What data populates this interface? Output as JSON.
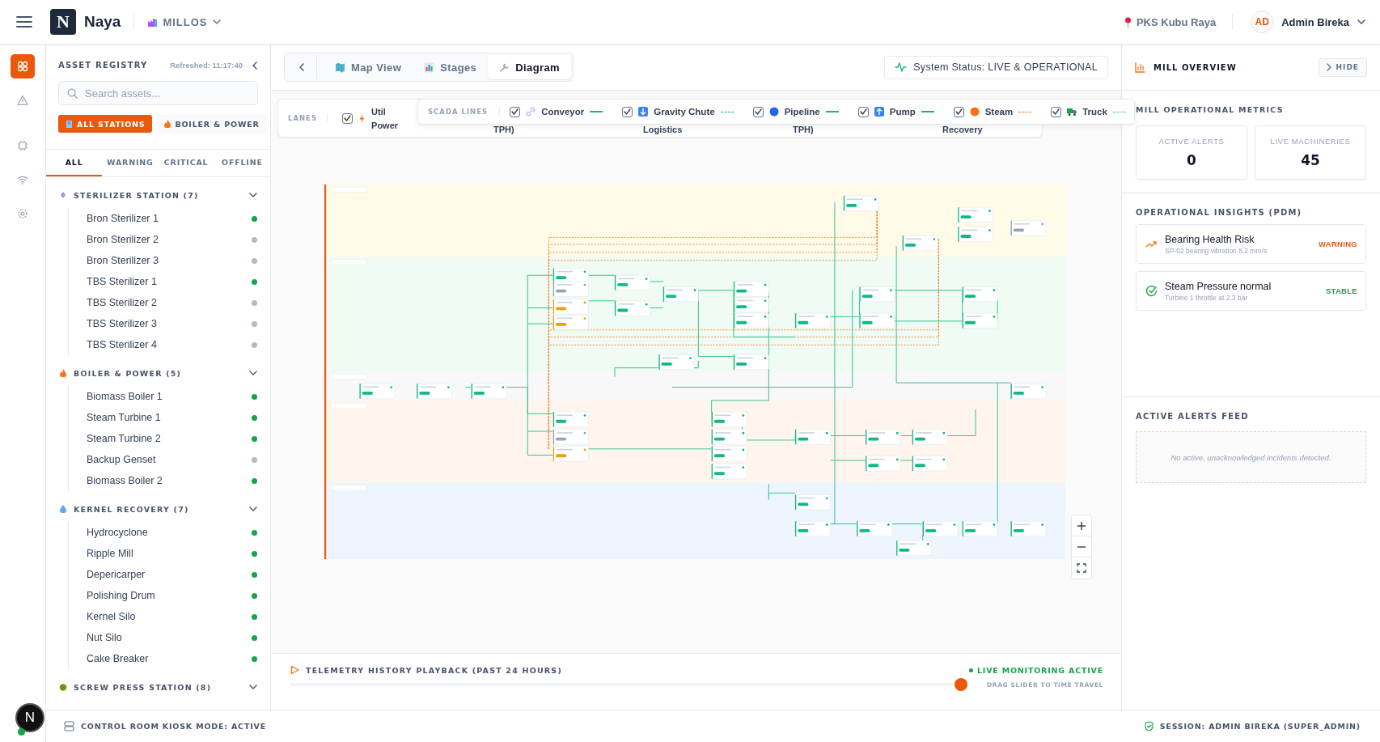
{
  "topbar": {
    "logo_letter": "N",
    "brand": "Naya",
    "mill": "MILLOS",
    "location": "PKS Kubu Raya",
    "user_initials": "AD",
    "user_name": "Admin Bireka"
  },
  "rail": {
    "items": [
      {
        "selected": true
      },
      {
        "selected": false
      },
      {
        "selected": false
      },
      {
        "selected": false
      },
      {
        "selected": false
      }
    ],
    "dev_badge": "N"
  },
  "sidebar": {
    "title": "ASSET REGISTRY",
    "refreshed": "Refreshed: 11:17:40",
    "search_placeholder": "Search assets...",
    "chips": [
      {
        "label": "ALL STATIONS",
        "selected": true
      },
      {
        "label": "BOILER & POWER",
        "selected": false
      }
    ],
    "filters": [
      {
        "label": "ALL",
        "selected": true
      },
      {
        "label": "WARNING",
        "selected": false
      },
      {
        "label": "CRITICAL",
        "selected": false
      },
      {
        "label": "OFFLINE",
        "selected": false
      }
    ],
    "groups": [
      {
        "name": "STERILIZER STATION (7)",
        "expanded": true,
        "items": [
          {
            "name": "Bron Sterilizer 1",
            "color": "#16a34a"
          },
          {
            "name": "Bron Sterilizer 2",
            "color": "#b4bac4"
          },
          {
            "name": "Bron Sterilizer 3",
            "color": "#b4bac4"
          },
          {
            "name": "TBS Sterilizer 1",
            "color": "#16a34a"
          },
          {
            "name": "TBS Sterilizer 2",
            "color": "#b4bac4"
          },
          {
            "name": "TBS Sterilizer 3",
            "color": "#b4bac4"
          },
          {
            "name": "TBS Sterilizer 4",
            "color": "#b4bac4"
          }
        ]
      },
      {
        "name": "BOILER & POWER (5)",
        "expanded": true,
        "items": [
          {
            "name": "Biomass Boiler 1",
            "color": "#16a34a"
          },
          {
            "name": "Steam Turbine 1",
            "color": "#16a34a"
          },
          {
            "name": "Steam Turbine 2",
            "color": "#16a34a"
          },
          {
            "name": "Backup Genset",
            "color": "#b4bac4"
          },
          {
            "name": "Biomass Boiler 2",
            "color": "#16a34a"
          }
        ]
      },
      {
        "name": "KERNEL RECOVERY (7)",
        "expanded": true,
        "items": [
          {
            "name": "Hydrocyclone",
            "color": "#16a34a"
          },
          {
            "name": "Ripple Mill",
            "color": "#16a34a"
          },
          {
            "name": "Depericarper",
            "color": "#16a34a"
          },
          {
            "name": "Polishing Drum",
            "color": "#16a34a"
          },
          {
            "name": "Kernel Silo",
            "color": "#16a34a"
          },
          {
            "name": "Nut Silo",
            "color": "#16a34a"
          },
          {
            "name": "Cake Breaker",
            "color": "#16a34a"
          }
        ]
      },
      {
        "name": "SCREW PRESS STATION (8)",
        "expanded": true
      }
    ]
  },
  "toolbar": {
    "tabs": [
      {
        "label": "Map View",
        "selected": false
      },
      {
        "label": "Stages",
        "selected": false
      },
      {
        "label": "Diagram",
        "selected": true
      }
    ],
    "system_status": "System Status: LIVE & OPERATIONAL"
  },
  "lanes": {
    "label": "LANES",
    "first": {
      "checked": true,
      "lines": [
        "Util",
        "Power"
      ]
    },
    "fragments": [
      "TPH)",
      "Logistics",
      "TPH)",
      "Recovery"
    ]
  },
  "scada": {
    "label": "SCADA LINES",
    "items": [
      {
        "label": "Conveyor",
        "checked": true,
        "kind": "solid",
        "color": "#10b981"
      },
      {
        "label": "Gravity Chute",
        "checked": true,
        "kind": "dashed",
        "color": "#10b981"
      },
      {
        "label": "Pipeline",
        "checked": true,
        "kind": "solid",
        "color": "#10b981"
      },
      {
        "label": "Pump",
        "checked": true,
        "kind": "solid",
        "color": "#10b981"
      },
      {
        "label": "Steam",
        "checked": true,
        "kind": "dashed",
        "color": "#f97316"
      },
      {
        "label": "Truck",
        "checked": true,
        "kind": "dotted",
        "color": "#10b981"
      }
    ]
  },
  "telemetry": {
    "title": "TELEMETRY HISTORY PLAYBACK (PAST 24 HOURS)",
    "live": "LIVE MONITORING ACTIVE",
    "level": 0.99,
    "hint": "DRAG SLIDER TO TIME TRAVEL"
  },
  "right_panel": {
    "title": "MILL OVERVIEW",
    "hide": "HIDE",
    "metrics_title": "MILL OPERATIONAL METRICS",
    "metrics": [
      {
        "label": "ACTIVE ALERTS",
        "value": "0"
      },
      {
        "label": "LIVE MACHINERIES",
        "value": "45"
      }
    ],
    "insights_title": "OPERATIONAL INSIGHTS (PDM)",
    "insights": [
      {
        "kind": "warning",
        "title": "Bearing Health Risk",
        "detail": "SP-02 bearing vibration 8.2 mm/s",
        "badge": "WARNING"
      },
      {
        "kind": "stable",
        "title": "Steam Pressure normal",
        "detail": "Turbine 1 throttle at 2.3 bar",
        "badge": "STABLE"
      }
    ],
    "alerts_title": "ACTIVE ALERTS FEED",
    "alerts_empty": "No active, unacknowledged incidents detected."
  },
  "status_bar": {
    "left": "CONTROL ROOM KIOSK MODE: ACTIVE",
    "right": "SESSION: ADMIN BIREKA (SUPER_ADMIN)"
  }
}
